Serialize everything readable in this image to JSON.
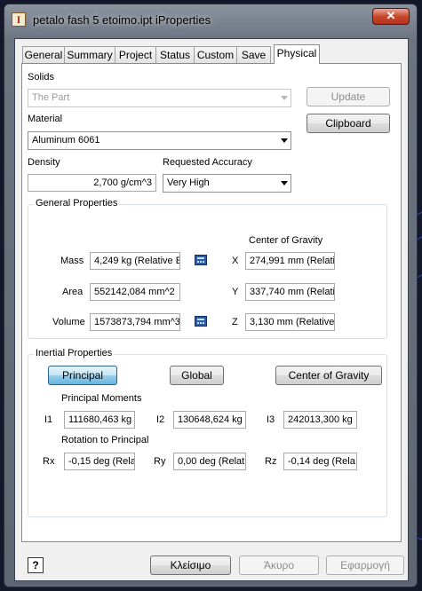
{
  "window": {
    "title": "petalo fash 5 etoimo.ipt iProperties",
    "close_glyph": "✕"
  },
  "tabs": [
    "General",
    "Summary",
    "Project",
    "Status",
    "Custom",
    "Save",
    "Physical"
  ],
  "physical": {
    "solids_label": "Solids",
    "solids_value": "The Part",
    "update_button": "Update",
    "material_label": "Material",
    "material_value": "Aluminum 6061",
    "clipboard_button": "Clipboard",
    "density_label": "Density",
    "density_value": "2,700 g/cm^3",
    "accuracy_label": "Requested Accuracy",
    "accuracy_value": "Very High"
  },
  "general_properties": {
    "title": "General Properties",
    "center_of_gravity_label": "Center of Gravity",
    "mass_label": "Mass",
    "mass_value": "4,249 kg (Relative E",
    "area_label": "Area",
    "area_value": "552142,084 mm^2",
    "volume_label": "Volume",
    "volume_value": "1573873,794 mm^3",
    "x_label": "X",
    "x_value": "274,991 mm (Relati",
    "y_label": "Y",
    "y_value": "337,740 mm (Relati",
    "z_label": "Z",
    "z_value": "3,130 mm (Relative"
  },
  "inertial_properties": {
    "title": "Inertial Properties",
    "principal_button": "Principal",
    "global_button": "Global",
    "cog_button": "Center of Gravity",
    "principal_moments_label": "Principal Moments",
    "i1_label": "I1",
    "i1_value": "111680,463 kg",
    "i2_label": "I2",
    "i2_value": "130648,624 kg",
    "i3_label": "I3",
    "i3_value": "242013,300 kg",
    "rotation_label": "Rotation to Principal",
    "rx_label": "Rx",
    "rx_value": "-0,15 deg (Rela",
    "ry_label": "Ry",
    "ry_value": "0,00 deg (Relat",
    "rz_label": "Rz",
    "rz_value": "-0,14 deg (Rela"
  },
  "footer": {
    "help_glyph": "?",
    "close_button": "Κλείσιμο",
    "cancel_button": "Άκυρο",
    "apply_button": "Εφαρμογή"
  }
}
